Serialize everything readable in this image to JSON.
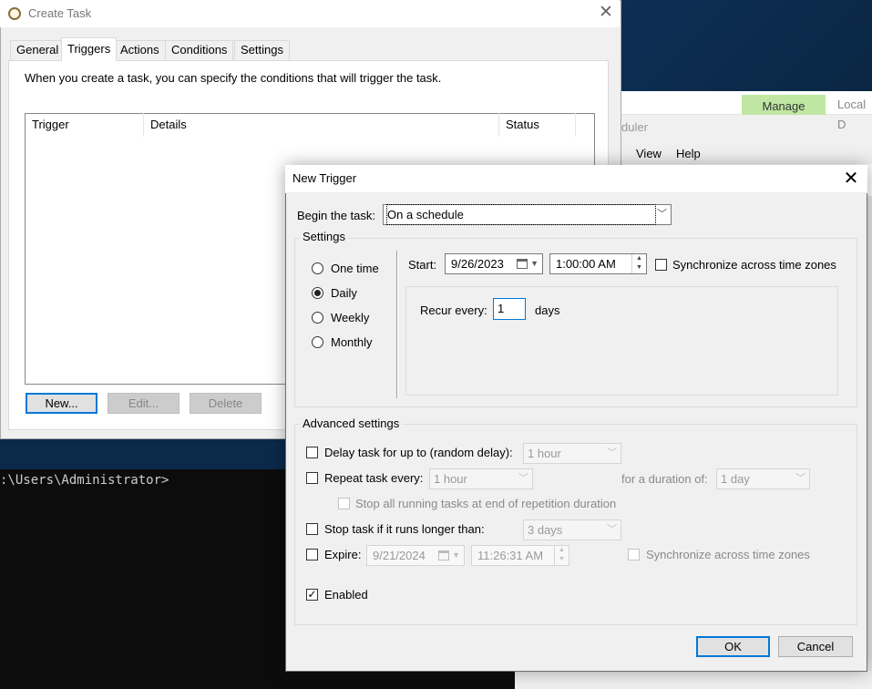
{
  "background": {
    "mmc_tab_manage": "Manage",
    "mmc_tab_local": "Local D",
    "mmc_title_fragment": "duler",
    "mmc_menu": [
      "View",
      "Help"
    ],
    "console_prompt": ":\\Users\\Administrator>"
  },
  "create_task": {
    "title": "Create Task",
    "tabs": [
      "General",
      "Triggers",
      "Actions",
      "Conditions",
      "Settings"
    ],
    "active_tab": "Triggers",
    "intro": "When you create a task, you can specify the conditions that will trigger the task.",
    "columns": [
      "Trigger",
      "Details",
      "Status"
    ],
    "buttons": {
      "new": "New...",
      "edit": "Edit...",
      "delete": "Delete"
    }
  },
  "new_trigger": {
    "title": "New Trigger",
    "begin_label": "Begin the task:",
    "begin_value": "On a schedule",
    "settings_label": "Settings",
    "schedule_options": [
      "One time",
      "Daily",
      "Weekly",
      "Monthly"
    ],
    "selected_schedule": "Daily",
    "start_label": "Start:",
    "start_date": "9/26/2023",
    "start_time": "1:00:00 AM",
    "sync_label": "Synchronize across time zones",
    "recur_label": "Recur every:",
    "recur_value": "1",
    "recur_unit": "days",
    "advanced_label": "Advanced settings",
    "delay_label": "Delay task for up to (random delay):",
    "delay_value": "1 hour",
    "repeat_label": "Repeat task every:",
    "repeat_value": "1 hour",
    "duration_label": "for a duration of:",
    "duration_value": "1 day",
    "stop_all_label": "Stop all running tasks at end of repetition duration",
    "stop_longer_label": "Stop task if it runs longer than:",
    "stop_longer_value": "3 days",
    "expire_label": "Expire:",
    "expire_date": "9/21/2024",
    "expire_time": "11:26:31 AM",
    "expire_sync_label": "Synchronize across time zones",
    "enabled_label": "Enabled",
    "enabled_checked": true,
    "ok": "OK",
    "cancel": "Cancel"
  },
  "colors": {
    "accent": "#0078d7",
    "manage_tab": "#bfe7a3",
    "console_bg": "#0c0c0c"
  }
}
